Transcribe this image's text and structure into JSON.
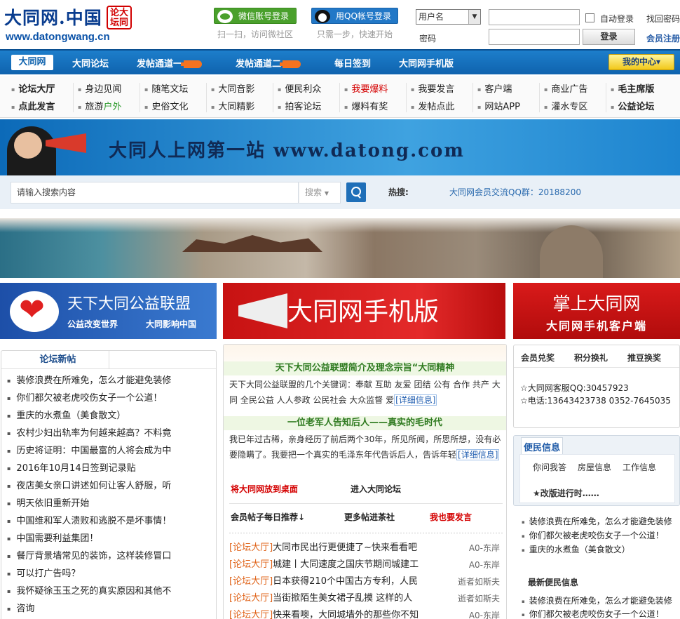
{
  "header": {
    "logo_main": "大同网.中国",
    "logo_seal": "论大坛同",
    "logo_url": "www.datongwang.cn",
    "wechat_login": "微信账号登录",
    "wechat_hint": "扫一扫，访问微社区",
    "qq_login": "用QQ帐号登录",
    "qq_hint": "只需一步，快速开始",
    "login_type_selected": "用户名",
    "password_label": "密码",
    "auto_login": "自动登录",
    "forgot": "找回密码",
    "login_button": "登录",
    "register": "会员注册"
  },
  "nav": {
    "items": [
      "大同网",
      "大同论坛",
      "发帖通道一",
      "发帖通道二",
      "每日签到",
      "大同网手机版"
    ],
    "my_center": "我的中心"
  },
  "submenu": {
    "row1": [
      "论坛大厅",
      "身边见闻",
      "随笔文坛",
      "大同音影",
      "便民利众",
      "我要爆料",
      "我要发言",
      "客户端",
      "商业广告",
      "毛主席版"
    ],
    "row2": [
      "点此发言",
      "旅游户外",
      "史俗文化",
      "大同精影",
      "拍客论坛",
      "爆料有奖",
      "发帖点此",
      "网站APP",
      "灌水专区",
      "公益论坛"
    ]
  },
  "banner": {
    "slogan": "大同人上网第一站  www.datong.com"
  },
  "search": {
    "placeholder": "请输入搜索内容",
    "type": "搜索",
    "hot_label": "热搜:",
    "hot_item": "大同网会员交流QQ群：20188200"
  },
  "tiles": {
    "left_title": "天下大同公益联盟",
    "left_sub1": "公益改变世界",
    "left_sub2": "大同影响中国",
    "mid_title": "大同网手机版",
    "right_title": "掌上大同网",
    "right_sub": "大同网手机客户端"
  },
  "forum_new": {
    "tab": "论坛新帖",
    "items": [
      "装修浪费在所难免，怎么才能避免装修",
      "你们都欠被老虎咬伤女子一个公道！",
      "重庆的水煮鱼（美食散文）",
      "农村少妇出轨率为何越来越高？不料竟",
      "历史将证明：中国最富的人将会成为中",
      "2016年10月14日签到记录贴",
      "夜店美女亲口讲述如何让客人舒服，听",
      "明天依旧重新开始",
      "中国维和军人溃败和逃脱不是坏事情！",
      "中国需要利益集团！",
      "餐厅背景墙常见的装饰，这样装修冒口",
      "可以打广告吗？",
      "我怀疑徐玉玉之死的真实原因和其他不",
      "咨询"
    ]
  },
  "center": {
    "h1": "天下大同公益联盟简介及理念宗旨“大同精神",
    "p1": "天下大同公益联盟的几个关键词：奉献  互助  友爱  团结 公有 合作 共产 大同 全民公益  人人参政  公民社会  大众监督 爱",
    "more": "[详细信息]",
    "h2": "一位老军人告知后人——真实的毛时代",
    "p2": "我已年过古稀，亲身经历了前后两个30年，所见所闻，所思所想，没有必要隐瞒了。我要把一个真实的毛泽东年代告诉后人，告诉年轻",
    "desk": "将大同网放到桌面",
    "enter": "进入大同论坛",
    "tab1": "会员帖子每日推荐↓",
    "tab2": "更多帖进茶社",
    "tab3": "我也要发言",
    "posts": [
      {
        "tag": "[论坛大厅]",
        "title": "大同市民出行更便捷了~快来看看吧",
        "author": "A0-东岸"
      },
      {
        "tag": "[论坛大厅]",
        "title": "城建丨大同速度之国庆节期间城建工",
        "author": "A0-东岸"
      },
      {
        "tag": "[论坛大厅]",
        "title": "日本获得210个中国古方专利，人民",
        "author": "逝者如斯夫"
      },
      {
        "tag": "[论坛大厅]",
        "title": "当街掀陌生美女裙子乱摸 这样的人",
        "author": "逝者如斯夫"
      },
      {
        "tag": "[论坛大厅]",
        "title": "快来看噢，大同城墙外的那些你不知",
        "author": "A0-东岸"
      }
    ]
  },
  "right": {
    "tabs": [
      "会员兑奖",
      "积分换礼",
      "推豆换奖"
    ],
    "service_qq": "☆大同网客服QQ:30457923",
    "phone": "☆电话:13643423738   0352-7645035",
    "convenience_title": "便民信息",
    "links": [
      "你问我答",
      "房屋信息",
      "工作信息"
    ],
    "notice": "★改版进行时……",
    "list1": [
      "装修浪费在所难免，怎么才能避免装修",
      "你们都欠被老虎咬伤女子一个公道！",
      "重庆的水煮鱼（美食散文）"
    ],
    "latest_title": "最新便民信息",
    "list2": [
      "装修浪费在所难免，怎么才能避免装修",
      "你们都欠被老虎咬伤女子一个公道！"
    ]
  },
  "colors": {
    "nav_blue": "#0f63ae",
    "red": "#d40000",
    "green": "#2e7a1f",
    "orange_tag": "#e0641a"
  }
}
